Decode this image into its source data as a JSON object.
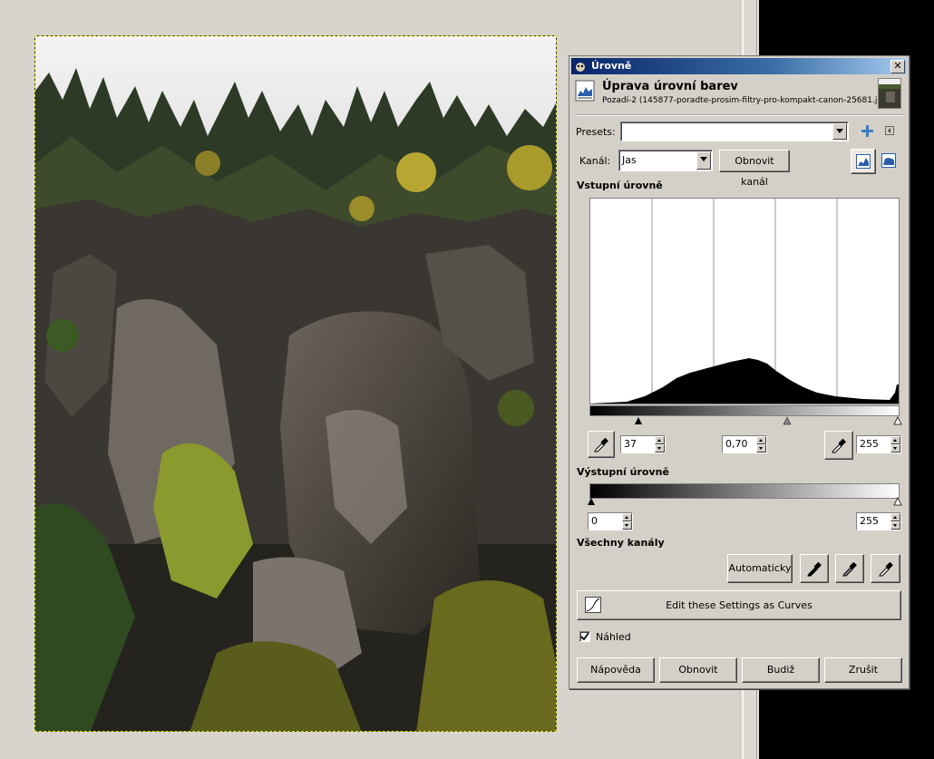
{
  "dialog": {
    "title": "Úrovně",
    "close_label": "✕",
    "header_title": "Úprava úrovní barev",
    "header_subtitle": "Pozadí-2 (145877-poradte-prosim-filtry-pro-kompakt-canon-25681.jpg)"
  },
  "presets": {
    "label": "Presets:",
    "value": ""
  },
  "channel": {
    "label": "Kanál:",
    "value": "Jas",
    "reset_label": "Obnovit kanál"
  },
  "input_levels": {
    "title": "Vstupní úrovně",
    "low": "37",
    "gamma": "0,70",
    "high": "255"
  },
  "output_levels": {
    "title": "Výstupní úrovně",
    "low": "0",
    "high": "255"
  },
  "all_channels": {
    "title": "Všechny kanály",
    "auto_label": "Automaticky"
  },
  "curves_button": "Edit these Settings as Curves",
  "preview": {
    "label": "Náhled",
    "checked": true
  },
  "buttons": {
    "help": "Nápověda",
    "reset": "Obnovit",
    "ok": "Budiž",
    "cancel": "Zrušit"
  },
  "colors": {
    "titlebar_start": "#0a246a",
    "titlebar_end": "#a6caf0",
    "selection": "#e0d800",
    "add_icon": "#3a7ec8"
  },
  "icons": [
    "gimp-icon",
    "levels-icon",
    "add-preset-icon",
    "menu-arrow-icon",
    "linear-histogram-icon",
    "log-histogram-icon",
    "eyedropper-icon",
    "curves-icon"
  ]
}
